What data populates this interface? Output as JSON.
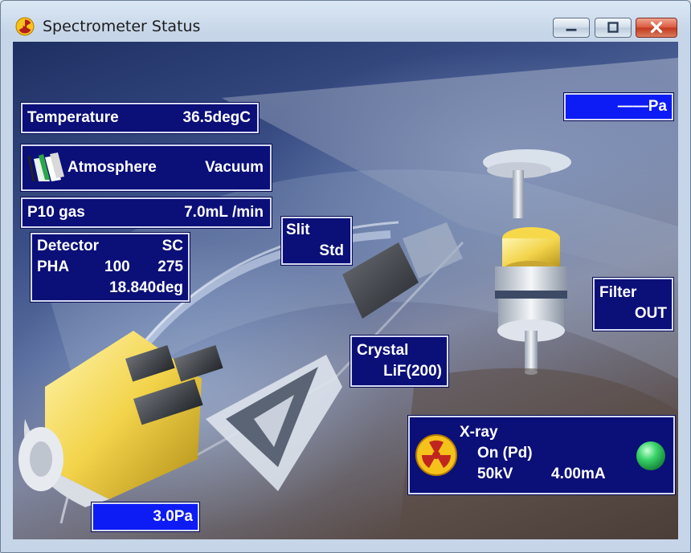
{
  "window": {
    "title": "Spectrometer Status"
  },
  "titlebar_buttons": {
    "minimize": "minimize",
    "maximize": "maximize",
    "close": "close"
  },
  "temperature": {
    "label": "Temperature",
    "value": "36.5degC"
  },
  "atmosphere": {
    "label": "Atmosphere",
    "value": "Vacuum"
  },
  "p10gas": {
    "label": "P10 gas",
    "value": "7.0mL /min"
  },
  "detector": {
    "label": "Detector",
    "type": "SC",
    "pha_label": "PHA",
    "pha_low": "100",
    "pha_high": "275",
    "angle": "18.840deg"
  },
  "pressure_top": {
    "value": "——Pa"
  },
  "slit": {
    "label": "Slit",
    "value": "Std"
  },
  "filter": {
    "label": "Filter",
    "value": "OUT"
  },
  "crystal": {
    "label": "Crystal",
    "value": "LiF(200)"
  },
  "xray": {
    "label": "X-ray",
    "state": "On (Pd)",
    "voltage": "50kV",
    "current": "4.00mA",
    "indicator_color": "#3ad46a"
  },
  "pressure_bottom": {
    "value": "3.0Pa"
  },
  "colors": {
    "panel": "#0b0f78",
    "highlight_panel": "#0d1cf5",
    "panel_border": "#d7dcf5"
  }
}
